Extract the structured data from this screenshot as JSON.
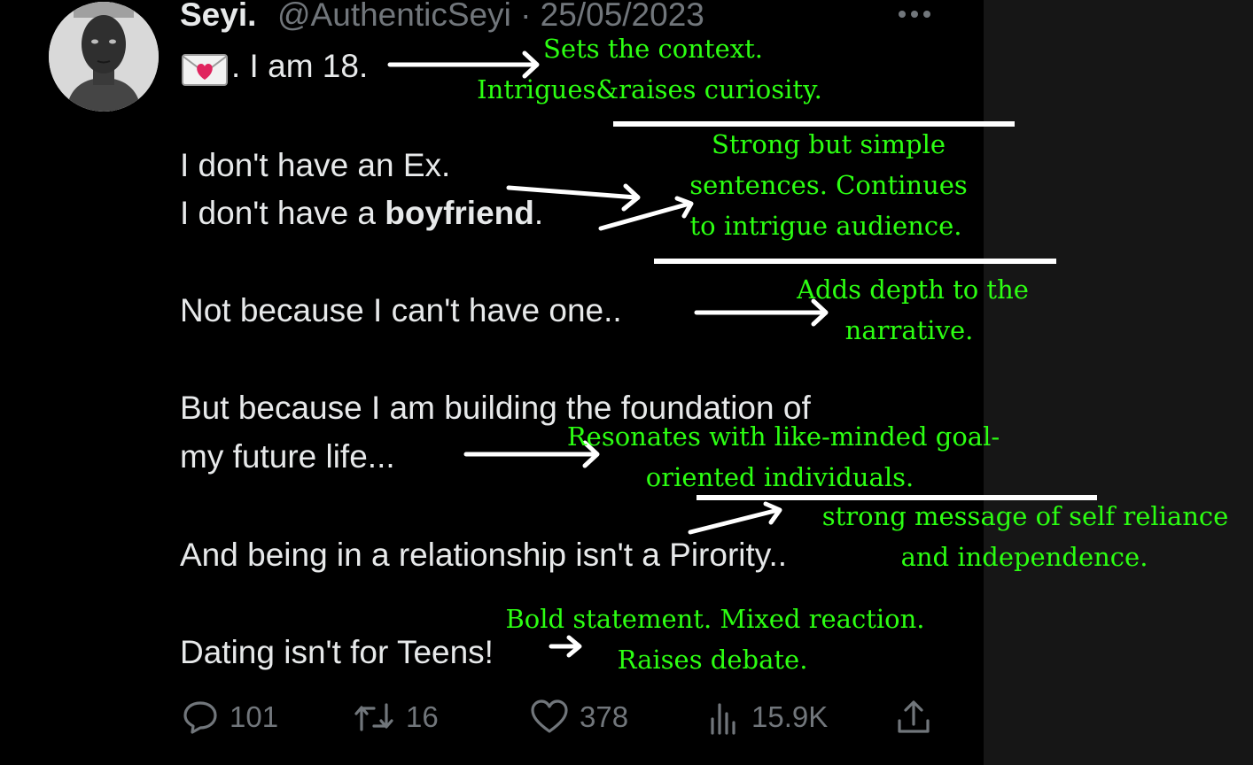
{
  "tweet": {
    "author_name": "Seyi.",
    "handle_date": "@AuthenticSeyi · 25/05/2023",
    "lines": {
      "l1": ". I am 18.",
      "l2": "I don't have an Ex.",
      "l3_prefix": "I don't have a ",
      "l3_bold": "boyfriend",
      "l3_suffix": ".",
      "l4": "Not because I can't have one..",
      "l5": "But because I am building the foundation of",
      "l6": "my future life...",
      "l7": "And being in a relationship isn't a Pirority..",
      "l8": "Dating isn't for Teens!"
    },
    "emoji_icon": "love-letter-icon"
  },
  "actions": {
    "replies": "101",
    "reposts": "16",
    "likes": "378",
    "views": "15.9K"
  },
  "annotations": {
    "n1": "Sets the context.",
    "n2": "Intrigues&raises curiosity.",
    "n3a": "Strong but simple",
    "n3b": "sentences. Continues",
    "n3c": "to intrigue audience.",
    "n4a": "Adds depth to the",
    "n4b": "narrative.",
    "n5a": "Resonates with like-minded goal-",
    "n5b": "oriented individuals.",
    "n6a": "strong message of self reliance",
    "n6b": "and independence.",
    "n7a": "Bold statement. Mixed reaction.",
    "n7b": "Raises debate."
  },
  "colors": {
    "annotation_text": "#2cff12",
    "tweet_text": "#e7e9ea",
    "secondary_text": "#71767b",
    "background": "#000000"
  }
}
